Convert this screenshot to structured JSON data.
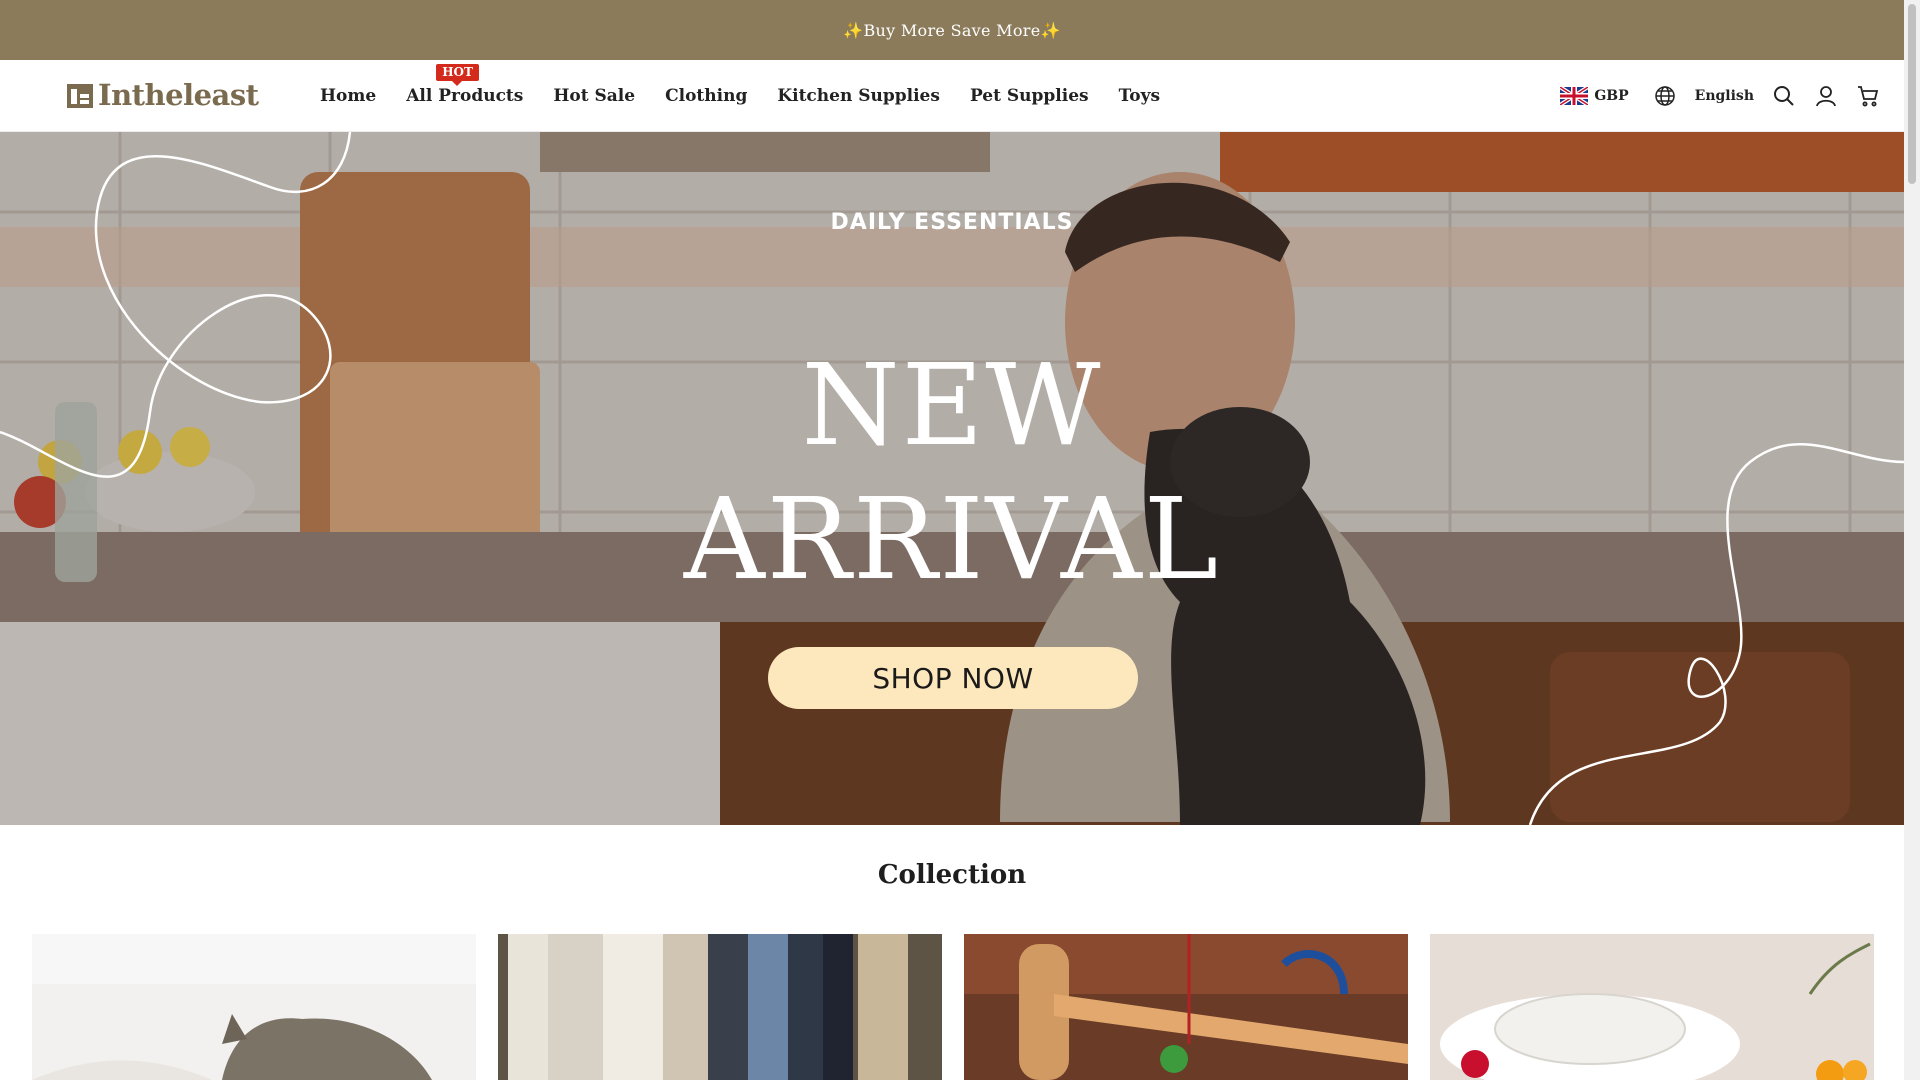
{
  "announcement": {
    "text": "✨Buy More Save More✨"
  },
  "header": {
    "logo_text": "Intheleast",
    "nav": [
      {
        "label": "Home"
      },
      {
        "label": "All Products",
        "badge": "HOT"
      },
      {
        "label": "Hot Sale"
      },
      {
        "label": "Clothing"
      },
      {
        "label": "Kitchen Supplies"
      },
      {
        "label": "Pet Supplies"
      },
      {
        "label": "Toys"
      }
    ],
    "currency": "GBP",
    "language": "English",
    "icons": [
      "uk-flag-icon",
      "globe-icon",
      "search-icon",
      "account-icon",
      "cart-icon"
    ]
  },
  "hero": {
    "kicker": "DAILY ESSENTIALS",
    "title_line1": "NEW",
    "title_line2": "ARRIVAL",
    "cta": "SHOP NOW"
  },
  "collection": {
    "title": "Collection",
    "cards": [
      "pet-cat-image",
      "clothing-rack-image",
      "wooden-toy-image",
      "kitchen-strainer-image"
    ]
  },
  "colors": {
    "announcement_bg": "#8b7b5b",
    "logo": "#7a6a4e",
    "hot_badge": "#d42a1c",
    "cta_bg": "#fde7bd"
  }
}
